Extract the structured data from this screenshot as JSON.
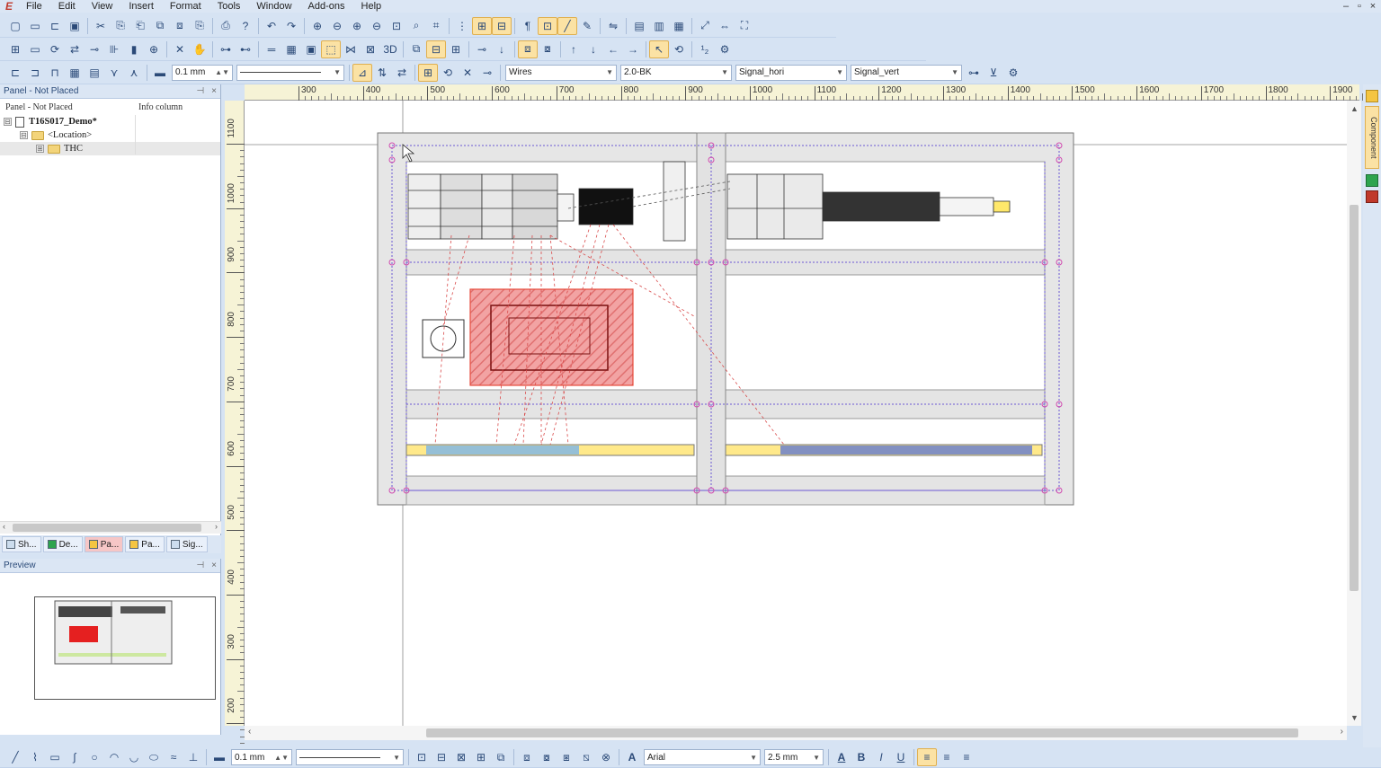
{
  "app": {
    "logo": "E"
  },
  "menu": [
    "File",
    "Edit",
    "View",
    "Insert",
    "Format",
    "Tools",
    "Window",
    "Add-ons",
    "Help"
  ],
  "window_controls": [
    "–",
    "▫",
    "×"
  ],
  "toolbar3": {
    "line_width": "0.1 mm",
    "wire_type": "Wires",
    "wire_spec": "2.0-BK",
    "signal_h": "Signal_hori",
    "signal_v": "Signal_vert"
  },
  "left_panel": {
    "title": "Panel - Not Placed",
    "col1": "Panel - Not Placed",
    "col2": "Info column",
    "tree": [
      {
        "label": "T16S017_Demo*",
        "level": 0,
        "toggle": "⊟",
        "type": "doc"
      },
      {
        "label": "<Location>",
        "level": 1,
        "toggle": "⊟",
        "type": "folder"
      },
      {
        "label": "THC",
        "level": 2,
        "toggle": "⊞",
        "type": "folder"
      }
    ],
    "tabs": [
      "Sh...",
      "De...",
      "Pa...",
      "Pa...",
      "Sig..."
    ]
  },
  "preview": {
    "title": "Preview"
  },
  "ruler_top": [
    "300",
    "400",
    "500",
    "600",
    "700",
    "800",
    "900",
    "1000",
    "1100",
    "1200",
    "1300",
    "1400",
    "1500",
    "1600",
    "1700",
    "1800",
    "1900"
  ],
  "ruler_left": [
    "1100",
    "1000",
    "900",
    "800",
    "700",
    "600",
    "500",
    "400",
    "300",
    "200"
  ],
  "right_dock": {
    "label": "Component"
  },
  "bottom_toolbar": {
    "line_width": "0.1 mm",
    "font": "Arial",
    "font_size": "2.5 mm",
    "bold": "B",
    "italic": "I",
    "underline": "U"
  },
  "colors": {
    "accent": "#fbe2a4",
    "selection": "#e74c3c",
    "handle": "#d04bb0"
  }
}
